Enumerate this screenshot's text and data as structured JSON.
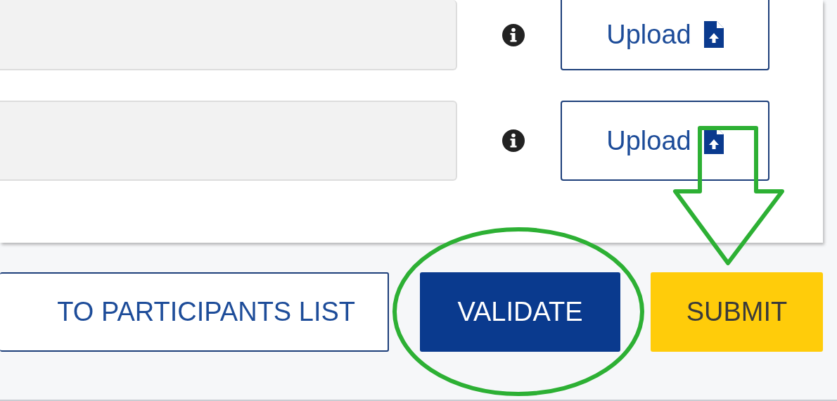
{
  "uploads": [
    {
      "button": "Upload"
    },
    {
      "button": "Upload"
    }
  ],
  "actions": [
    {
      "label": "TO PARTICIPANTS LIST",
      "kind": "outline"
    },
    {
      "label": "VALIDATE",
      "kind": "primary"
    },
    {
      "label": "SUBMIT",
      "kind": "warning"
    }
  ]
}
